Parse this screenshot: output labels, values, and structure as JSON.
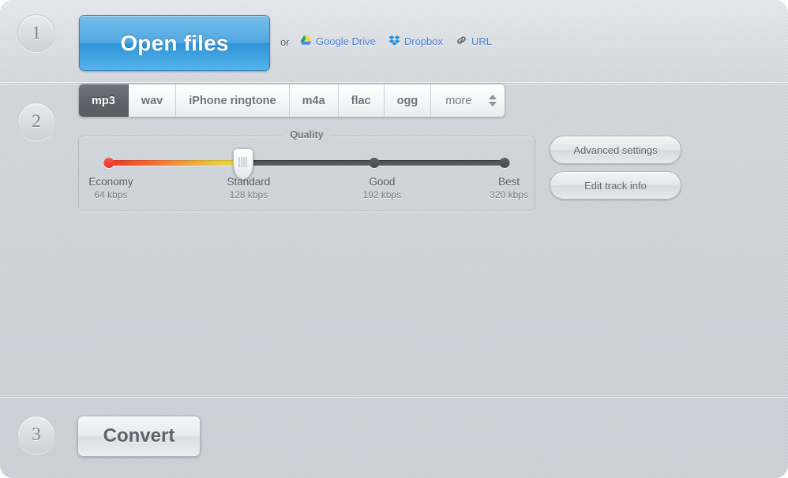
{
  "steps": {
    "one": "1",
    "two": "2",
    "three": "3"
  },
  "step1": {
    "open_files_label": "Open files",
    "or_label": "or",
    "cloud_links": [
      {
        "label": "Google Drive",
        "icon": "google-drive-icon"
      },
      {
        "label": "Dropbox",
        "icon": "dropbox-icon"
      },
      {
        "label": "URL",
        "icon": "link-icon"
      }
    ]
  },
  "step2": {
    "format_tabs": [
      {
        "label": "mp3",
        "active": true
      },
      {
        "label": "wav",
        "active": false
      },
      {
        "label": "iPhone ringtone",
        "active": false
      },
      {
        "label": "m4a",
        "active": false
      },
      {
        "label": "flac",
        "active": false
      },
      {
        "label": "ogg",
        "active": false
      }
    ],
    "more_tab": {
      "label": "more",
      "icon": "stepper-arrows-icon"
    },
    "quality": {
      "legend": "Quality",
      "selected_index": 1,
      "stops": [
        {
          "name": "Economy",
          "rate": "64 kbps",
          "pos": 0
        },
        {
          "name": "Standard",
          "rate": "128 kbps",
          "pos": 34
        },
        {
          "name": "Good",
          "rate": "192 kbps",
          "pos": 67
        },
        {
          "name": "Best",
          "rate": "320 kbps",
          "pos": 100
        }
      ]
    },
    "advanced_settings_label": "Advanced settings",
    "edit_track_info_label": "Edit track info"
  },
  "step3": {
    "convert_label": "Convert"
  },
  "colors": {
    "primary_button": "#53a9e2",
    "link": "#4a7fc9",
    "active_tab_bg": "#5d646c",
    "quality_low": "#f0372b",
    "quality_high": "#e5de3f",
    "page_bg": "#c8cdd3"
  }
}
